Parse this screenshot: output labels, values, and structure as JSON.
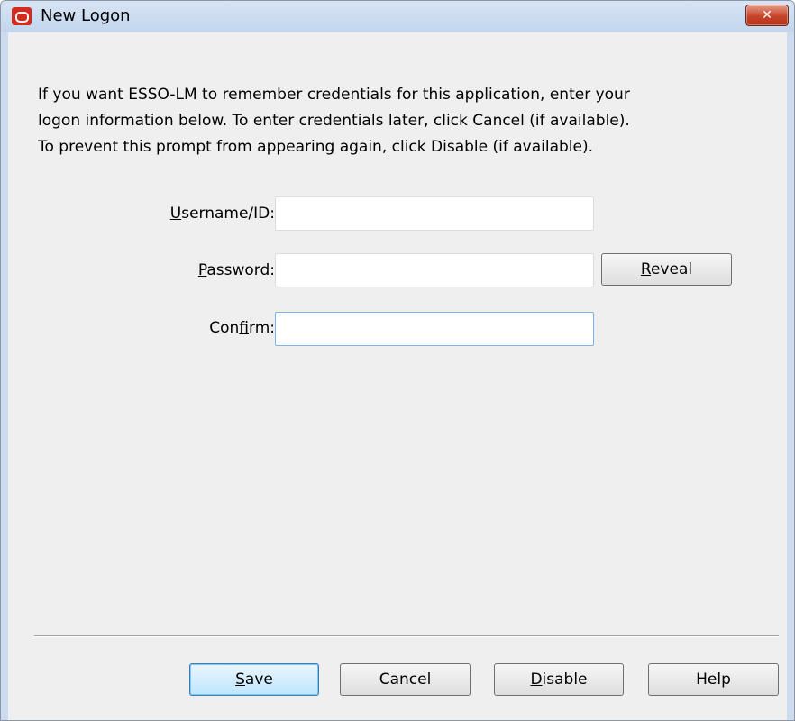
{
  "window": {
    "title": "New Logon",
    "close_label": "✕"
  },
  "intro": {
    "line1": "If you want ESSO-LM to remember credentials for this application, enter your",
    "line2": "logon information below. To enter credentials later, click Cancel (if available).",
    "line3": "To prevent this prompt from appearing again, click Disable (if available)."
  },
  "fields": {
    "username": {
      "label_mnemonic": "U",
      "label_rest": "sername/ID:",
      "value": ""
    },
    "password": {
      "label_mnemonic": "P",
      "label_rest": "assword:",
      "value": ""
    },
    "confirm": {
      "label_pre": "Con",
      "label_mnemonic": "f",
      "label_rest": "irm:",
      "value": ""
    }
  },
  "reveal_button": {
    "mnemonic": "R",
    "rest": "eveal"
  },
  "footer": {
    "save": {
      "mnemonic": "S",
      "rest": "ave"
    },
    "cancel": {
      "label": "Cancel"
    },
    "disable": {
      "mnemonic": "D",
      "rest": "isable"
    },
    "help": {
      "label": "Help"
    }
  },
  "colors": {
    "titlebar": "#c9daef",
    "client_background": "#efefef",
    "close_button": "#c6442a",
    "focus_border": "#7eb4ea"
  },
  "icons": {
    "app": "oracle-logo-icon",
    "close": "close-icon"
  }
}
